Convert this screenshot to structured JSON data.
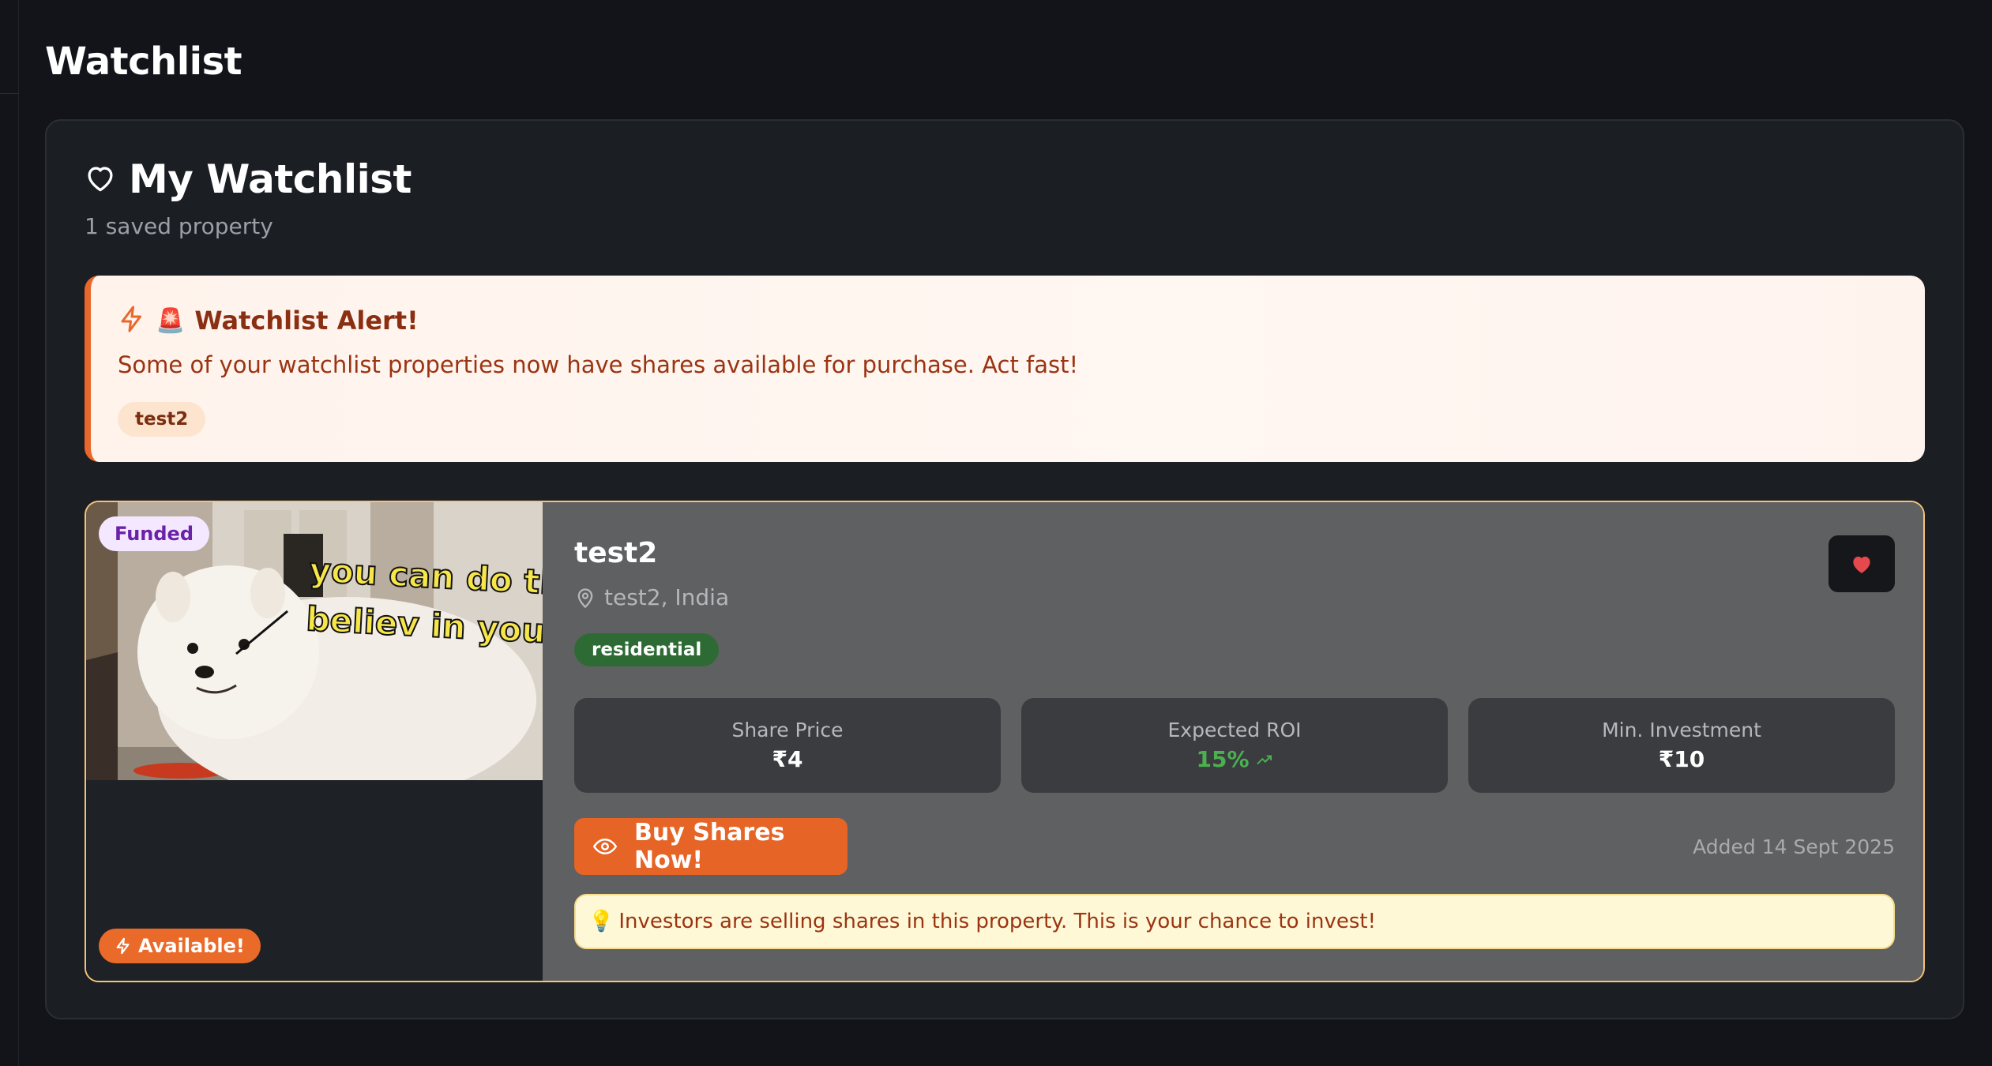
{
  "page": {
    "title": "Watchlist"
  },
  "watchlist": {
    "title": "My Watchlist",
    "subtitle": "1 saved property",
    "title_icon": "heart-outline-icon"
  },
  "alert": {
    "icon": "lightning-icon",
    "siren": "🚨",
    "title": "Watchlist Alert!",
    "message": "Some of your watchlist properties now have shares available for purchase. Act fast!",
    "chips": [
      "test2"
    ]
  },
  "property": {
    "name": "test2",
    "location": "test2, India",
    "type": "residential",
    "status_badge": "Funded",
    "availability_badge": "Available!",
    "image_caption_line1": "you can do th",
    "image_caption_line2": "believ in yours",
    "stats": [
      {
        "label": "Share Price",
        "value": "₹4"
      },
      {
        "label": "Expected ROI",
        "value": "15%"
      },
      {
        "label": "Min. Investment",
        "value": "₹10"
      }
    ],
    "buy_label": "Buy Shares Now!",
    "added_date": "Added 14 Sept 2025",
    "note_icon": "💡",
    "note": "Investors are selling shares in this property. This is your chance to invest!",
    "favorited": true
  },
  "colors": {
    "accent": "#e56426",
    "funded_badge_bg": "#f3e8ff",
    "roi_green": "#4caf50",
    "card_border": "#f5c27a"
  }
}
